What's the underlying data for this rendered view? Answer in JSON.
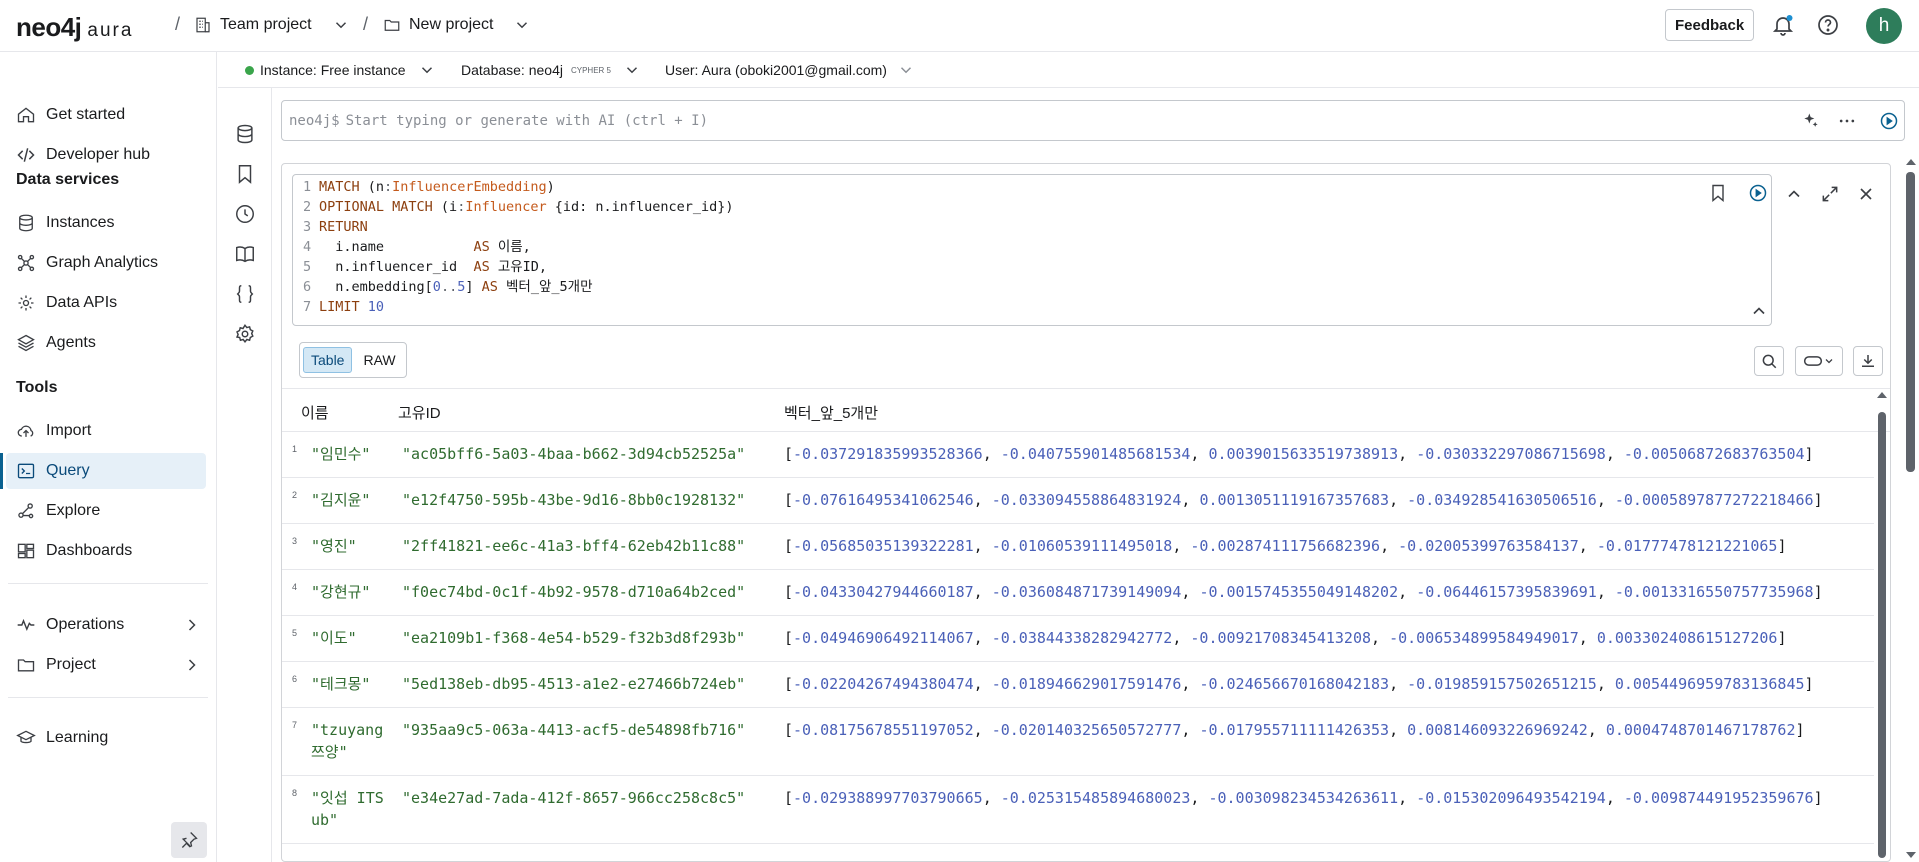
{
  "topbar": {
    "logo_main": "neo4j",
    "logo_sub": "aura",
    "crumb_sep": "/",
    "project_org": "Team project",
    "project_name": "New project",
    "feedback_label": "Feedback",
    "avatar_letter": "h"
  },
  "sidebar": {
    "items_top": [
      {
        "label": "Get started",
        "icon": "home-icon"
      },
      {
        "label": "Developer hub",
        "icon": "code-icon"
      }
    ],
    "section_data": "Data services",
    "items_data": [
      {
        "label": "Instances",
        "icon": "database-icon"
      },
      {
        "label": "Graph Analytics",
        "icon": "graph-analytics-icon"
      },
      {
        "label": "Data APIs",
        "icon": "api-icon"
      },
      {
        "label": "Agents",
        "icon": "layers-icon"
      }
    ],
    "section_tools": "Tools",
    "items_tools": [
      {
        "label": "Import",
        "icon": "cloud-upload-icon"
      },
      {
        "label": "Query",
        "icon": "terminal-icon",
        "active": true
      },
      {
        "label": "Explore",
        "icon": "explore-icon"
      },
      {
        "label": "Dashboards",
        "icon": "dashboard-icon"
      }
    ],
    "items_more": [
      {
        "label": "Operations",
        "icon": "pulse-icon"
      },
      {
        "label": "Project",
        "icon": "folder-icon"
      }
    ],
    "learning": {
      "label": "Learning",
      "icon": "graduation-cap-icon"
    }
  },
  "instancebar": {
    "instance": "Instance: Free instance",
    "database": "Database: neo4j",
    "database_version": "CYPHER 5",
    "user": "User: Aura (oboki2001@gmail.com)"
  },
  "editor": {
    "prompt": "neo4j$",
    "placeholder": "Start typing or generate with AI (ctrl + I)"
  },
  "query": {
    "lines": [
      "1",
      "2",
      "3",
      "4",
      "5",
      "6",
      "7"
    ],
    "l1": {
      "kw": "MATCH",
      "p1": " (n",
      "p2": ":",
      "label": "InfluencerEmbedding",
      "p3": ")"
    },
    "l2": {
      "kw": "OPTIONAL MATCH",
      "p1": " (i",
      "p2": ":",
      "label": "Influencer",
      "p3": " {id: n.influencer_id})"
    },
    "l3": {
      "kw": "RETURN"
    },
    "l4": {
      "p1": "  i.name           ",
      "kw": "AS",
      "p2": " 이름,"
    },
    "l5": {
      "p1": "  n.influencer_id  ",
      "kw": "AS",
      "p2": " 고유ID,"
    },
    "l6": {
      "p1": "  n.embedding[",
      "n1": "0",
      "op": "..",
      "n2": "5",
      "p2": "] ",
      "kw": "AS",
      "p3": " 벡터_앞_5개만"
    },
    "l7": {
      "kw": "LIMIT",
      "n": " 10"
    }
  },
  "results": {
    "tabs": [
      "Table",
      "RAW"
    ],
    "active_tab": "Table",
    "columns": [
      "이름",
      "고유ID",
      "벡터_앞_5개만"
    ],
    "rows": [
      {
        "n": "1",
        "name": "\"임민수\"",
        "id": "\"ac05bff6-5a03-4baa-b662-3d94cb52525a\"",
        "vec": [
          "-0.037291835993528366",
          "-0.040755901485681534",
          "0.0039015633519738913",
          "-0.030332297086715698",
          "-0.00506872683763504"
        ]
      },
      {
        "n": "2",
        "name": "\"김지윤\"",
        "id": "\"e12f4750-595b-43be-9d16-8bb0c1928132\"",
        "vec": [
          "-0.07616495341062546",
          "-0.033094558864831924",
          "0.0013051119167357683",
          "-0.034928541630506516",
          "-0.0005897877272218466"
        ]
      },
      {
        "n": "3",
        "name": "\"영진\"",
        "id": "\"2ff41821-ee6c-41a3-bff4-62eb42b11c88\"",
        "vec": [
          "-0.05685035139322281",
          "-0.01060539111495018",
          "-0.002874111756682396",
          "-0.02005399763584137",
          "-0.01777478121221065"
        ]
      },
      {
        "n": "4",
        "name": "\"강현규\"",
        "id": "\"f0ec74bd-0c1f-4b92-9578-d710a64b2ced\"",
        "vec": [
          "-0.04330427944660187",
          "-0.036084871739149094",
          "-0.0015745355049148202",
          "-0.06446157395839691",
          "-0.0013316550757735968"
        ]
      },
      {
        "n": "5",
        "name": "\"이도\"",
        "id": "\"ea2109b1-f368-4e54-b529-f32b3d8f293b\"",
        "vec": [
          "-0.04946906492114067",
          "-0.03844338282942772",
          "-0.00921708345413208",
          "-0.006534899584949017",
          "0.003302408615127206"
        ]
      },
      {
        "n": "6",
        "name": "\"테크몽\"",
        "id": "\"5ed138eb-db95-4513-a1e2-e27466b724eb\"",
        "vec": [
          "-0.02204267494380474",
          "-0.018946629017591476",
          "-0.024656670168042183",
          "-0.019859157502651215",
          "0.0054496959783136845"
        ]
      },
      {
        "n": "7",
        "name": "\"tzuyang 쯔양\"",
        "id": "\"935aa9c5-063a-4413-acf5-de54898fb716\"",
        "vec": [
          "-0.08175678551197052",
          "-0.020140325650572777",
          "-0.017955711111426353",
          "0.008146093226969242",
          "0.0004748701467178762"
        ]
      },
      {
        "n": "8",
        "name": "\"잇섭 ITSub\"",
        "id": "\"e34e27ad-7ada-412f-8657-966cc258c8c5\"",
        "vec": [
          "-0.029388997703790665",
          "-0.025315485894680023",
          "-0.003098234534263611",
          "-0.015302096493542194",
          "-0.009874491952359676"
        ]
      }
    ]
  }
}
